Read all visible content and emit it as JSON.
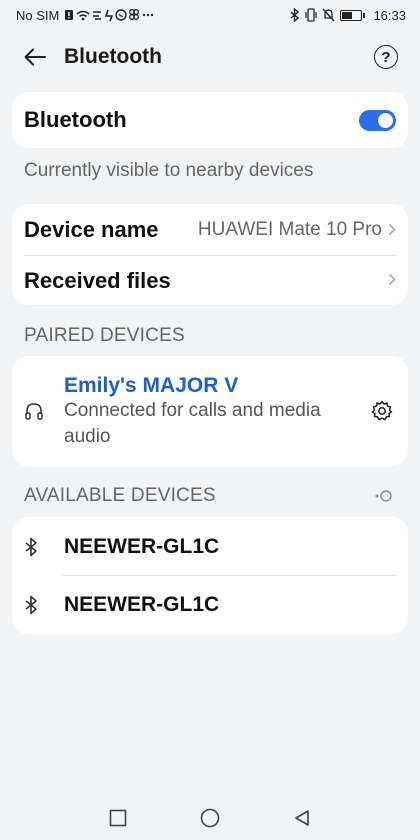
{
  "status_bar": {
    "carrier": "No SIM",
    "time": "16:33"
  },
  "header": {
    "title": "Bluetooth",
    "help_icon": "?"
  },
  "bluetooth": {
    "label": "Bluetooth",
    "enabled": true,
    "visibility_text": "Currently visible to nearby devices"
  },
  "settings": {
    "device_name_label": "Device name",
    "device_name_value": "HUAWEI Mate 10 Pro",
    "received_files_label": "Received files"
  },
  "paired": {
    "header": "PAIRED DEVICES",
    "devices": [
      {
        "name": "Emily's MAJOR V",
        "status_line1": "Connected for calls and media",
        "status_line2": "audio",
        "icon": "headphones-icon"
      }
    ]
  },
  "available": {
    "header": "AVAILABLE DEVICES",
    "devices": [
      {
        "name": "NEEWER-GL1C",
        "icon": "bluetooth-icon"
      },
      {
        "name": "NEEWER-GL1C",
        "icon": "bluetooth-icon"
      }
    ]
  },
  "colors": {
    "accent": "#2a6ee8",
    "paired_name": "#1f5fc9",
    "background": "#f1f3f5"
  },
  "nav": {
    "buttons": [
      "recents-icon",
      "home-icon",
      "back-nav-icon"
    ]
  }
}
